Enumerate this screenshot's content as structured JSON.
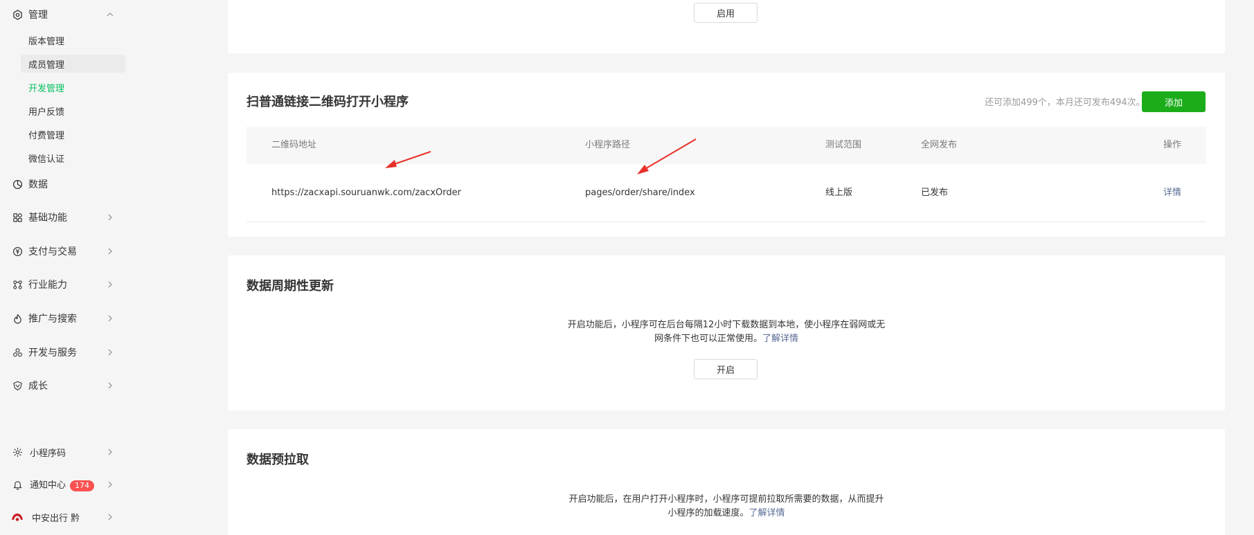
{
  "sidebar": {
    "manage": {
      "label": "管理",
      "icon": "manage-gear-icon"
    },
    "manage_items": [
      {
        "label": "版本管理"
      },
      {
        "label": "成员管理"
      },
      {
        "label": "开发管理"
      },
      {
        "label": "用户反馈"
      },
      {
        "label": "付费管理"
      },
      {
        "label": "微信认证"
      }
    ],
    "groups": [
      {
        "label": "数据",
        "icon": "pie-chart-icon"
      },
      {
        "label": "基础功能",
        "icon": "grid-icon"
      },
      {
        "label": "支付与交易",
        "icon": "yuan-icon"
      },
      {
        "label": "行业能力",
        "icon": "nodes-icon"
      },
      {
        "label": "推广与搜索",
        "icon": "flame-icon"
      },
      {
        "label": "开发与服务",
        "icon": "cubes-icon"
      },
      {
        "label": "成长",
        "icon": "shield-icon"
      }
    ],
    "bottom": {
      "qrcode": {
        "label": "小程序码",
        "icon": "sun-icon"
      },
      "notify": {
        "label": "通知中心",
        "icon": "bell-icon",
        "badge": "174"
      },
      "account": {
        "label": "中安出行 黔",
        "icon": "account-logo-icon"
      }
    }
  },
  "top_card": {
    "enable_button": "启用"
  },
  "qr_card": {
    "title": "扫普通链接二维码打开小程序",
    "quota": "还可添加499个，本月还可发布494次。",
    "add_button": "添加",
    "columns": {
      "url": "二维码地址",
      "path": "小程序路径",
      "scope": "测试范围",
      "publish": "全网发布",
      "action": "操作"
    },
    "rows": [
      {
        "url": "https://zacxapi.souruanwk.com/zacxOrder",
        "path": "pages/order/share/index",
        "scope": "线上版",
        "publish": "已发布",
        "action": "详情"
      }
    ]
  },
  "periodic_card": {
    "title": "数据周期性更新",
    "desc_line1": "开启功能后，小程序可在后台每隔12小时下载数据到本地，使小程序在弱网或无",
    "desc_line2": "网条件下也可以正常使用。",
    "learn_more": "了解详情",
    "open_button": "开启"
  },
  "prefetch_card": {
    "title": "数据预拉取",
    "desc_line1": "开启功能后，在用户打开小程序时，小程序可提前拉取所需要的数据，从而提升",
    "desc_line2": "小程序的加载速度。",
    "learn_more": "了解详情"
  },
  "colors": {
    "brand_green": "#1aad19",
    "active_green": "#07c160",
    "link_blue": "#576b95",
    "badge_red": "#fa5151",
    "annotation_red": "#e8302a"
  }
}
